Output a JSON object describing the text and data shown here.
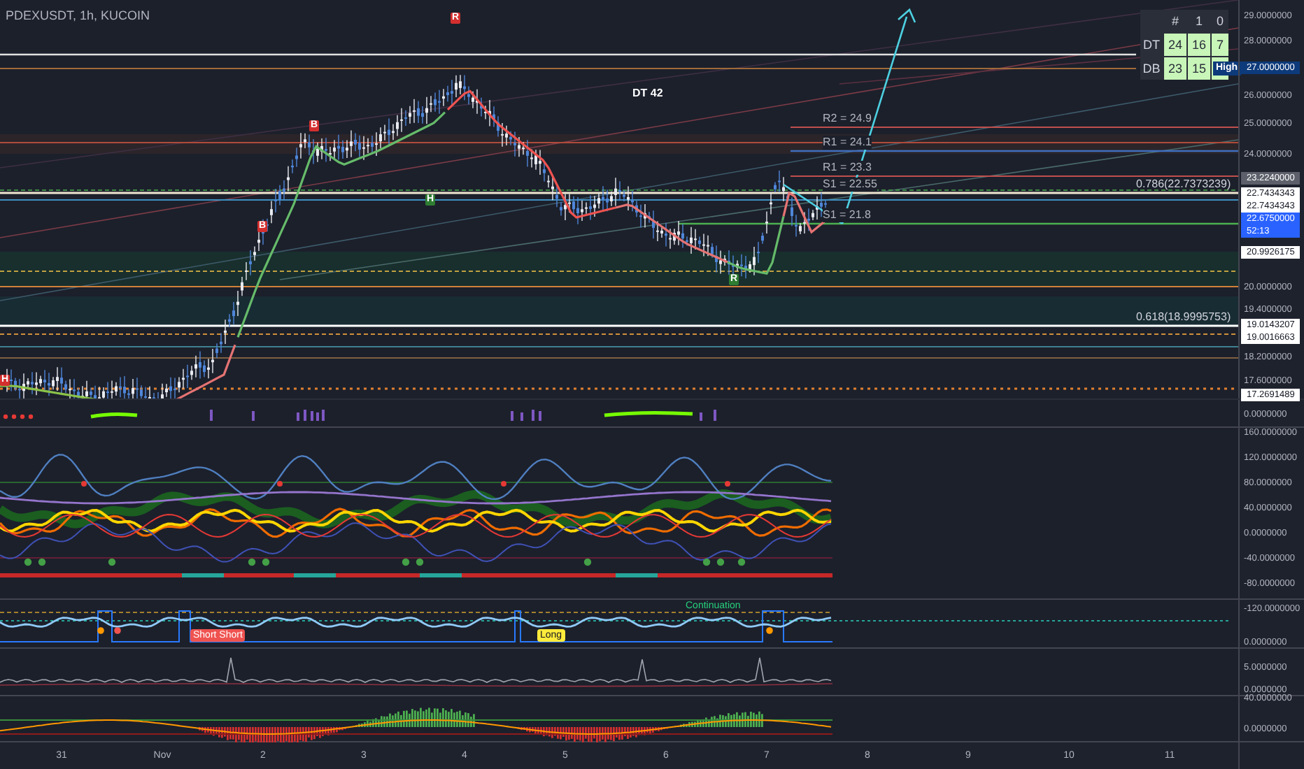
{
  "header": {
    "symbol": "PDEXUSDT, 1h, KUCOIN"
  },
  "stats_table": {
    "columns": [
      "#",
      "1",
      "0"
    ],
    "rows": [
      {
        "label": "DT",
        "cells": [
          "24",
          "16",
          "7"
        ]
      },
      {
        "label": "DB",
        "cells": [
          "23",
          "15"
        ]
      }
    ],
    "badge": "High"
  },
  "main_pane": {
    "axis_ticks": [
      "29.0000000",
      "28.0000000",
      "26.0000000",
      "25.0000000",
      "24.0000000",
      "20.0000000",
      "19.4000000",
      "18.2000000",
      "17.6000000"
    ],
    "price_tags": [
      {
        "text": "27.0000000",
        "kind": "navy"
      },
      {
        "text": "23.2240000",
        "kind": "gray"
      },
      {
        "text": "22.7434343",
        "kind": "white"
      },
      {
        "text": "22.7434343",
        "kind": "white"
      },
      {
        "text": "22.6750000",
        "kind": "blue",
        "countdown": "52:13"
      },
      {
        "text": "20.9926175",
        "kind": "white"
      },
      {
        "text": "19.0143207",
        "kind": "white"
      },
      {
        "text": "19.0016663",
        "kind": "white"
      },
      {
        "text": "17.2691489",
        "kind": "white"
      }
    ],
    "annotations": [
      "DT 42",
      "R2 = 24.9",
      "R1 = 24.1",
      "R1 = 23.3",
      "S1 = 22.55",
      "S1 = 21.8",
      "0.786(22.7373239)",
      "0.618(18.9995753)"
    ],
    "markers": [
      {
        "text": "R",
        "color": "#d32f2f"
      },
      {
        "text": "H",
        "color": "#2e7d32"
      },
      {
        "text": "R",
        "color": "#2e7d32"
      },
      {
        "text": "H",
        "color": "#d32f2f"
      },
      {
        "text": "B",
        "color": "#d32f2f"
      },
      {
        "text": "B",
        "color": "#d32f2f"
      }
    ]
  },
  "volume_pane": {
    "axis_ticks": [
      "0.0000000"
    ]
  },
  "oscillator_pane": {
    "axis_ticks": [
      "160.0000000",
      "120.0000000",
      "80.0000000",
      "40.0000000",
      "0.0000000",
      "-40.0000000",
      "-80.0000000",
      "-120.0000000"
    ]
  },
  "signal_pane": {
    "axis_ticks": [
      "0.0000000"
    ],
    "signals": [
      {
        "text": "Short Short",
        "kind": "red"
      },
      {
        "text": "Long",
        "kind": "yellow"
      },
      {
        "text": "Continuation",
        "kind": "green"
      }
    ]
  },
  "volatility_pane": {
    "axis_ticks": [
      "5.0000000",
      "0.0000000"
    ]
  },
  "momentum_pane": {
    "axis_ticks": [
      "40.0000000",
      "0.0000000"
    ]
  },
  "time_axis": [
    "31",
    "Nov",
    "2",
    "3",
    "4",
    "5",
    "6",
    "7",
    "8",
    "9",
    "10",
    "11"
  ]
}
